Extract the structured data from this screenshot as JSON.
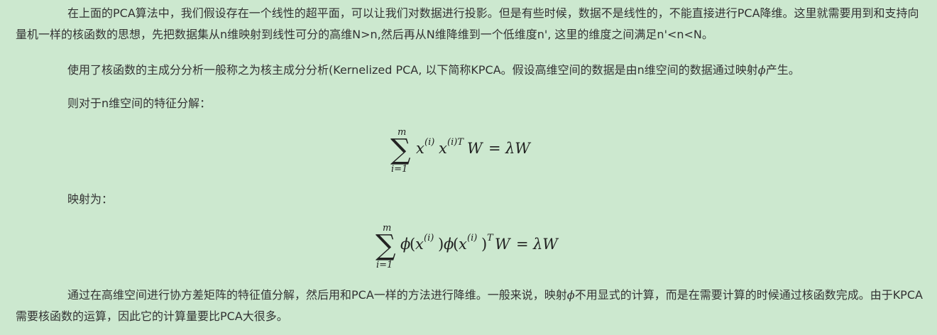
{
  "paragraphs": {
    "p1": "在上面的PCA算法中，我们假设存在一个线性的超平面，可以让我们对数据进行投影。但是有些时候，数据不是线性的，不能直接进行PCA降维。这里就需要用到和支持向量机一样的核函数的思想，先把数据集从n维映射到线性可分的高维N>n,然后再从N维降维到一个低维度n', 这里的维度之间满足n'<n<N。",
    "p2_before": "使用了核函数的主成分分析一般称之为核主成分分析(Kernelized PCA, 以下简称KPCA。假设高维空间的数据是由n维空间的数据通过映射",
    "p2_symbol": "ϕ",
    "p2_after": "产生。",
    "p3": "则对于n维空间的特征分解：",
    "p4": "映射为：",
    "p5_before": "通过在高维空间进行协方差矩阵的特征值分解，然后用和PCA一样的方法进行降维。一般来说，映射",
    "p5_symbol": "ϕ",
    "p5_after": "不用显式的计算，而是在需要计算的时候通过核函数完成。由于KPCA需要核函数的运算，因此它的计算量要比PCA大很多。"
  },
  "formulas": {
    "f1": {
      "sum": "∑",
      "upper": "m",
      "lower": "i=1",
      "x1": "x",
      "sup1": "(i)",
      "x2": "x",
      "sup2": "(i)T",
      "w": "W",
      "eq": "=",
      "lambda": "λW"
    },
    "f2": {
      "sum": "∑",
      "upper": "m",
      "lower": "i=1",
      "phi1": "ϕ",
      "open1": "(",
      "x1": "x",
      "sup1": "(i)",
      "close1": ")",
      "phi2": "ϕ",
      "open2": "(",
      "x2": "x",
      "sup2": "(i)",
      "close2": ")",
      "sup3": "T",
      "w": "W",
      "eq": "=",
      "lambda": "λW"
    }
  }
}
